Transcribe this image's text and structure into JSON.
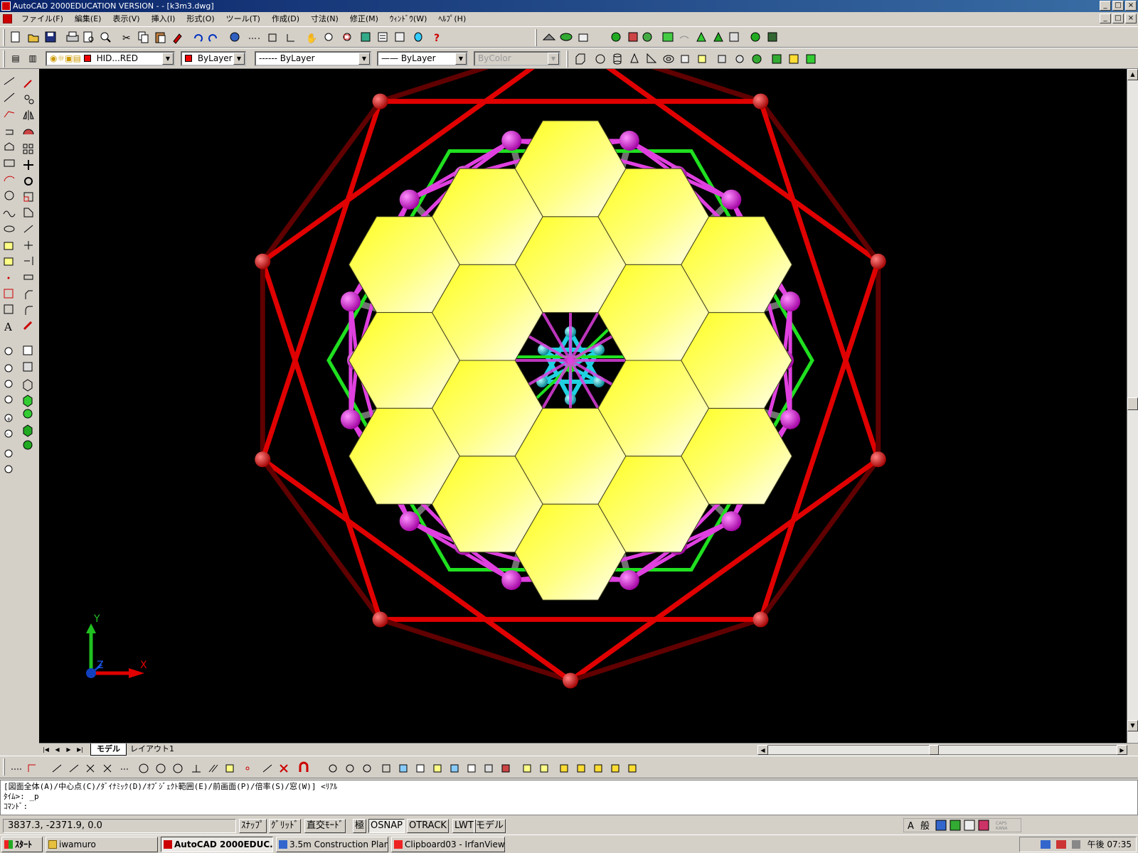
{
  "window": {
    "title": "AutoCAD 2000EDUCATION VERSION - - [k3m3.dwg]",
    "minimize": "_",
    "maximize": "□",
    "close": "×"
  },
  "menu": {
    "items": [
      "ファイル(F)",
      "編集(E)",
      "表示(V)",
      "挿入(I)",
      "形式(O)",
      "ツール(T)",
      "作成(D)",
      "寸法(N)",
      "修正(M)",
      "ｳｨﾝﾄﾞｳ(W)",
      "ﾍﾙﾌﾟ(H)"
    ]
  },
  "properties_toolbar": {
    "layer": "HID...RED",
    "color": "ByLayer",
    "linetype": "------ ByLayer",
    "lineweight": "—— ByLayer",
    "plotstyle": "ByColor"
  },
  "layout_tabs": {
    "model": "モデル",
    "layout1": "レイアウト1"
  },
  "command_window": {
    "line1": "[図面全体(A)/中心点(C)/ﾀﾞｲﾅﾐｯｸ(D)/ｵﾌﾞｼﾞｪｸﾄ範囲(E)/前画面(P)/倍率(S)/窓(W)] <ﾘｱﾙ",
    "line2": "ﾀｲﾑ>:  _p",
    "line3": "ｺﾏﾝﾄﾞ:"
  },
  "status": {
    "coords": "3837.3,  -2371.9, 0.0",
    "snap": "ｽﾅｯﾌﾟ",
    "grid": "ｸﾞﾘｯﾄﾞ",
    "ortho": "直交ﾓｰﾄﾞ",
    "polar": "極",
    "osnap": "OSNAP",
    "otrack": "OTRACK",
    "lwt": "LWT",
    "model": "モデル"
  },
  "ucs": {
    "x": "X",
    "y": "Y",
    "z": "Z"
  },
  "taskbar": {
    "start": "ｽﾀｰﾄ",
    "tasks": [
      "iwamuro",
      "AutoCAD 2000EDUC...",
      "3.5m Construction Plan -...",
      "Clipboard03 - IrfanView"
    ],
    "clock": "午後 07:35"
  },
  "colors": {
    "titlebar": "#0a246a",
    "canvas": "#000000",
    "frame_red": "#e00000",
    "strut_magenta": "#e040e0",
    "mirror_yellow": "#ffff40",
    "inner_cyan": "#20d0e0",
    "inner_green": "#20e020"
  },
  "icons": [
    "new-icon",
    "open-icon",
    "save-icon",
    "print-icon",
    "cut-icon",
    "copy-icon",
    "paste-icon",
    "undo-icon",
    "redo-icon",
    "help-icon",
    "line-icon",
    "circle-icon",
    "move-icon",
    "rotate-icon",
    "zoom-icon"
  ]
}
